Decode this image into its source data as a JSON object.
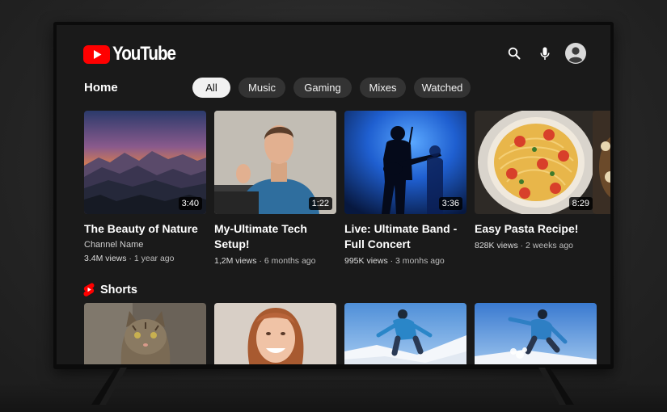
{
  "header": {
    "logo_text": "YouTube",
    "icons": [
      "search-icon",
      "microphone-icon",
      "account-icon"
    ]
  },
  "nav": {
    "home_label": "Home",
    "chips": [
      {
        "label": "All",
        "active": true
      },
      {
        "label": "Music",
        "active": false
      },
      {
        "label": "Gaming",
        "active": false
      },
      {
        "label": "Mixes",
        "active": false
      },
      {
        "label": "Watched",
        "active": false
      }
    ]
  },
  "videos": [
    {
      "title": "The Beauty of Nature",
      "channel": "Channel Name",
      "views": "3.4M views",
      "age": "1 year ago",
      "duration": "3:40",
      "thumbnail": "mountain-sunset"
    },
    {
      "title": "My-Ultimate Tech Setup!",
      "channel": "",
      "views": "1,2M views",
      "age": "6 months ago",
      "duration": "1:22",
      "thumbnail": "man-talking"
    },
    {
      "title": "Live: Ultimate Band - Full Concert",
      "channel": "",
      "views": "995K views",
      "age": "3 monhs ago",
      "duration": "3:36",
      "thumbnail": "guitarist-on-stage"
    },
    {
      "title": "Easy Pasta Recipe!",
      "channel": "",
      "views": "828K views",
      "age": "2 weeks ago",
      "duration": "8:29",
      "thumbnail": "spaghetti-bowl"
    }
  ],
  "shorts": {
    "label": "Shorts",
    "items": [
      {
        "thumbnail": "tabby-cat"
      },
      {
        "thumbnail": "smiling-woman"
      },
      {
        "thumbnail": "snowboarder"
      },
      {
        "thumbnail": "snowboarder-jump"
      }
    ]
  },
  "colors": {
    "brand_red": "#FF0000",
    "background": "#1a1a1a",
    "chip_bg": "#333333",
    "chip_active_bg": "#f1f1f1"
  }
}
